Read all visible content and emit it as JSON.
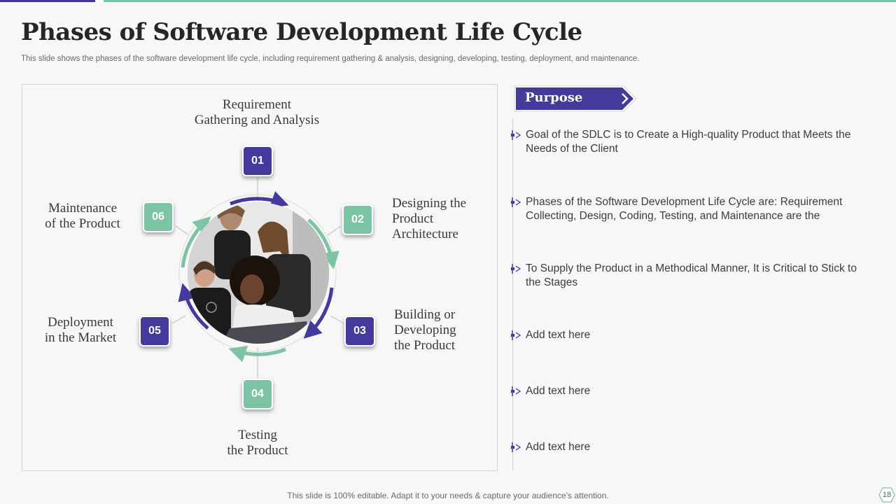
{
  "slide": {
    "title": "Phases of Software Development Life Cycle",
    "subtitle": "This slide shows the phases of the software development life cycle, including requirement gathering & analysis, designing, developing, testing, deployment, and maintenance.",
    "footer": "This slide is 100% editable. Adapt it to your needs & capture your audience’s attention.",
    "page_number": "18"
  },
  "colors": {
    "purple": "#433a9b",
    "green": "#7cc4a3"
  },
  "phases": [
    {
      "number": "01",
      "lines": [
        "Requirement",
        "Gathering and Analysis"
      ],
      "color": "purple"
    },
    {
      "number": "02",
      "lines": [
        "Designing the",
        "Product",
        "Architecture"
      ],
      "color": "green"
    },
    {
      "number": "03",
      "lines": [
        "Building or",
        "Developing",
        "the Product"
      ],
      "color": "purple"
    },
    {
      "number": "04",
      "lines": [
        "Testing",
        "the Product"
      ],
      "color": "green"
    },
    {
      "number": "05",
      "lines": [
        "Deployment",
        "in the Market"
      ],
      "color": "purple"
    },
    {
      "number": "06",
      "lines": [
        "Maintenance",
        "of the Product"
      ],
      "color": "green"
    }
  ],
  "purpose": {
    "heading": "Purpose",
    "items": [
      "Goal of the SDLC is to Create a High-quality  Product that Meets the Needs of the Client",
      "Phases of the Software Development Life Cycle are: Requirement Collecting, Design, Coding, Testing,  and Maintenance  are the",
      "To Supply the Product in a Methodical Manner,  It is Critical to Stick to the Stages",
      "Add text here",
      "Add text here",
      "Add text here"
    ]
  },
  "icons": {
    "purpose_marker": "double-chevron-marker-icon",
    "purpose_tab_arrow": "chevron-right-icon"
  }
}
